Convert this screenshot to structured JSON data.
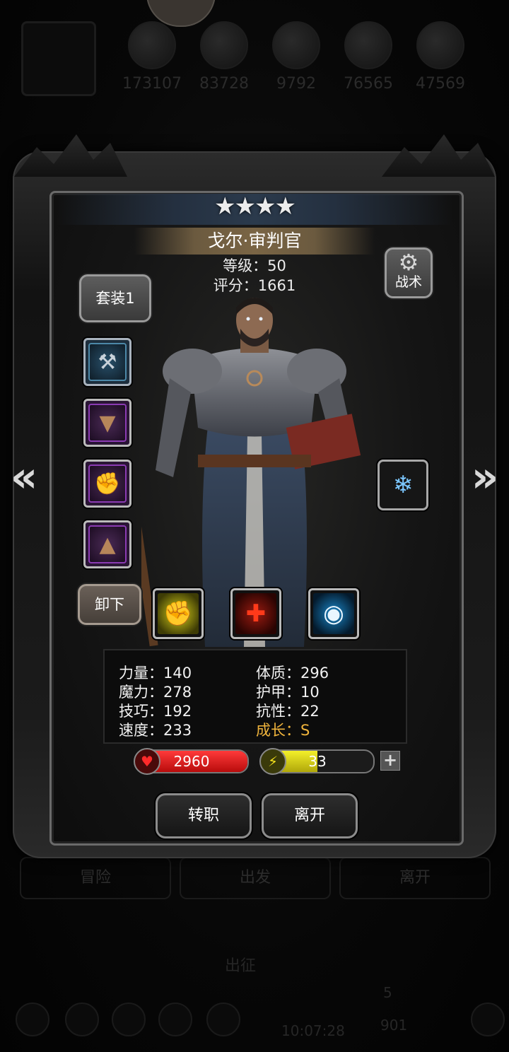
{
  "background": {
    "resources": [
      "173107",
      "83728",
      "9792",
      "76565",
      "47569"
    ],
    "tabs": [
      "冒险",
      "出发",
      "离开"
    ],
    "expedition_label": "出征",
    "timer": "10:07:28",
    "count_a": "5",
    "count_b": "901"
  },
  "hero": {
    "stars": "★★★★",
    "name": "戈尔·审判官",
    "level_text": "等级：50",
    "score_text": "评分：1661"
  },
  "buttons": {
    "set": "套装1",
    "tactics": "战术",
    "unequip": "卸下",
    "change_job": "转职",
    "leave": "离开"
  },
  "icons": {
    "nav_left": "double-chevron-left",
    "nav_right": "double-chevron-right",
    "tactics": "gear-icon",
    "skills": [
      "fist-icon",
      "red-cross-icon",
      "eye-icon"
    ],
    "equipment": [
      "hammer-icon",
      "cloak-icon",
      "gauntlet-icon",
      "cape-icon"
    ],
    "accessory": "crystal-icon"
  },
  "stats": {
    "strength": "力量：140",
    "magic": "魔力：278",
    "skill": "技巧：192",
    "speed": "速度：233",
    "constitution": "体质：296",
    "armor": "护甲：10",
    "resistance": "抗性：22",
    "growth": "成长：S"
  },
  "bars": {
    "hp": "2960",
    "hp_fill": 1.0,
    "energy": "33",
    "energy_fill": 0.5
  },
  "colors": {
    "growth": "#f0b43c",
    "hp": "#d91818",
    "energy": "#e6dc1c"
  }
}
